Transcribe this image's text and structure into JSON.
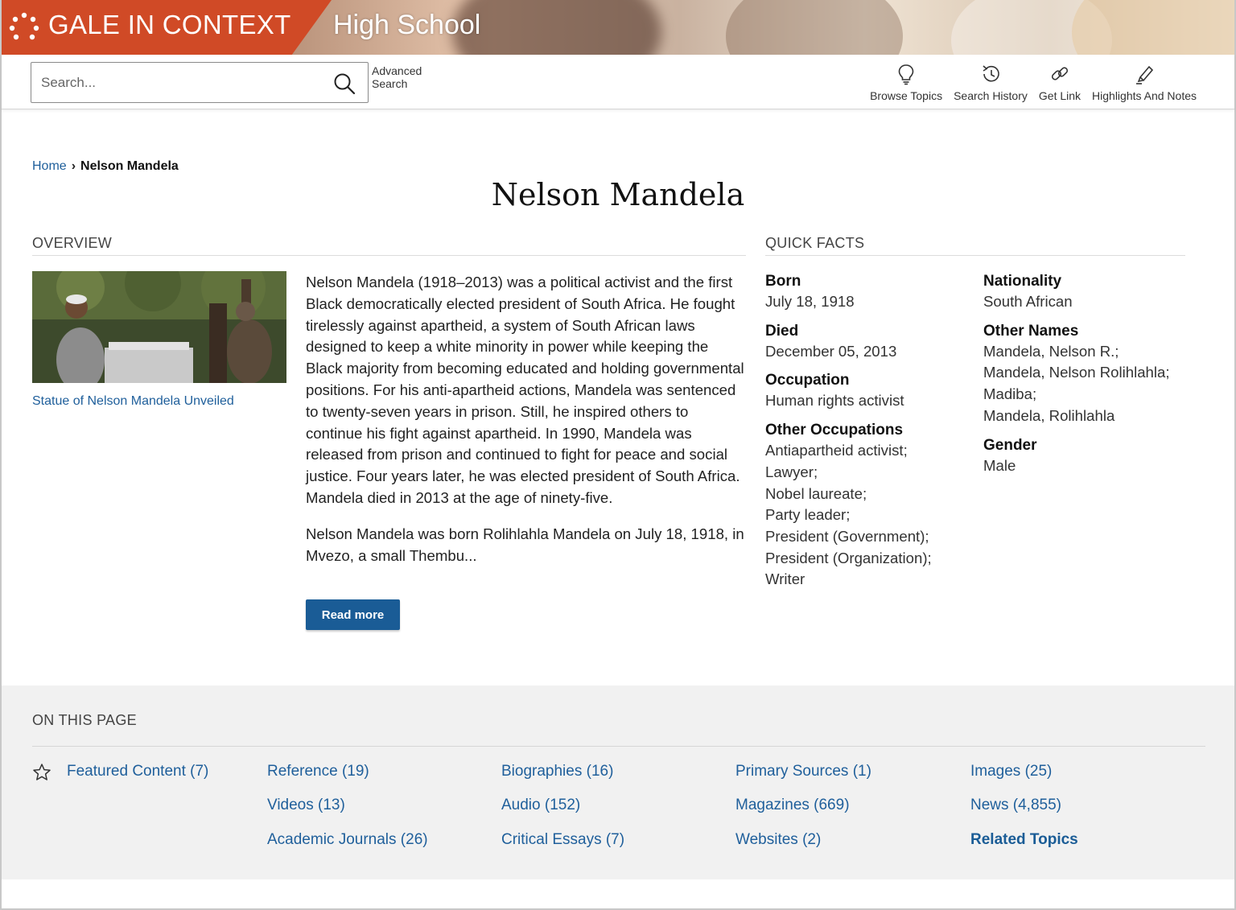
{
  "banner": {
    "brand": "GALE IN CONTEXT",
    "level": "High School",
    "brand_color": "#d04a26"
  },
  "toolbar": {
    "search_placeholder": "Search...",
    "search_icon": "search-icon",
    "advanced_search": "Advanced Search",
    "tools": [
      {
        "label": "Browse Topics",
        "icon": "lightbulb-icon"
      },
      {
        "label": "Search History",
        "icon": "history-icon"
      },
      {
        "label": "Get Link",
        "icon": "link-icon"
      },
      {
        "label": "Highlights And Notes",
        "icon": "highlighter-icon"
      }
    ]
  },
  "breadcrumb": {
    "home": "Home",
    "current": "Nelson Mandela"
  },
  "page_title": "Nelson Mandela",
  "overview": {
    "heading": "OVERVIEW",
    "image_caption": "Statue of Nelson Mandela Unveiled",
    "paragraph1": "Nelson Mandela (1918–2013) was a political activist and the first Black democratically elected president of South Africa. He fought tirelessly against apartheid, a system of South African laws designed to keep a white minority in power while keeping the Black majority from becoming educated and holding governmental positions. For his anti-apartheid actions, Mandela was sentenced to twenty-seven years in prison. Still, he inspired others to continue his fight against apartheid. In 1990, Mandela was released from prison and continued to fight for peace and social justice. Four years later, he was elected president of South Africa. Mandela died in 2013 at the age of ninety-five.",
    "paragraph2": "Nelson Mandela was born Rolihlahla Mandela on July 18, 1918, in Mvezo, a small Thembu...",
    "read_more": "Read more"
  },
  "quick_facts": {
    "heading": "QUICK FACTS",
    "born_label": "Born",
    "born_value": "July 18, 1918",
    "died_label": "Died",
    "died_value": "December 05, 2013",
    "occupation_label": "Occupation",
    "occupation_value": "Human rights activist",
    "other_occupations_label": "Other Occupations",
    "other_occupations": [
      "Antiapartheid activist;",
      "Lawyer;",
      "Nobel laureate;",
      "Party leader;",
      "President (Government);",
      "President (Organization);",
      "Writer"
    ],
    "nationality_label": "Nationality",
    "nationality_value": "South African",
    "other_names_label": "Other Names",
    "other_names": [
      "Mandela, Nelson R.;",
      "Mandela, Nelson Rolihlahla;",
      "Madiba;",
      "Mandela, Rolihlahla"
    ],
    "gender_label": "Gender",
    "gender_value": "Male"
  },
  "on_this_page": {
    "heading": "ON THIS PAGE",
    "featured": "Featured Content  (7)",
    "reference": "Reference  (19)",
    "biographies": "Biographies  (16)",
    "primary_sources": "Primary Sources  (1)",
    "images": "Images  (25)",
    "videos": "Videos  (13)",
    "audio": "Audio  (152)",
    "magazines": "Magazines  (669)",
    "news": "News  (4,855)",
    "academic_journals": "Academic Journals  (26)",
    "critical_essays": "Critical Essays  (7)",
    "websites": "Websites  (2)",
    "related_topics": "Related Topics"
  },
  "colors": {
    "link": "#1f5f9b",
    "button": "#1a5c96",
    "panel": "#f1f1f1"
  }
}
